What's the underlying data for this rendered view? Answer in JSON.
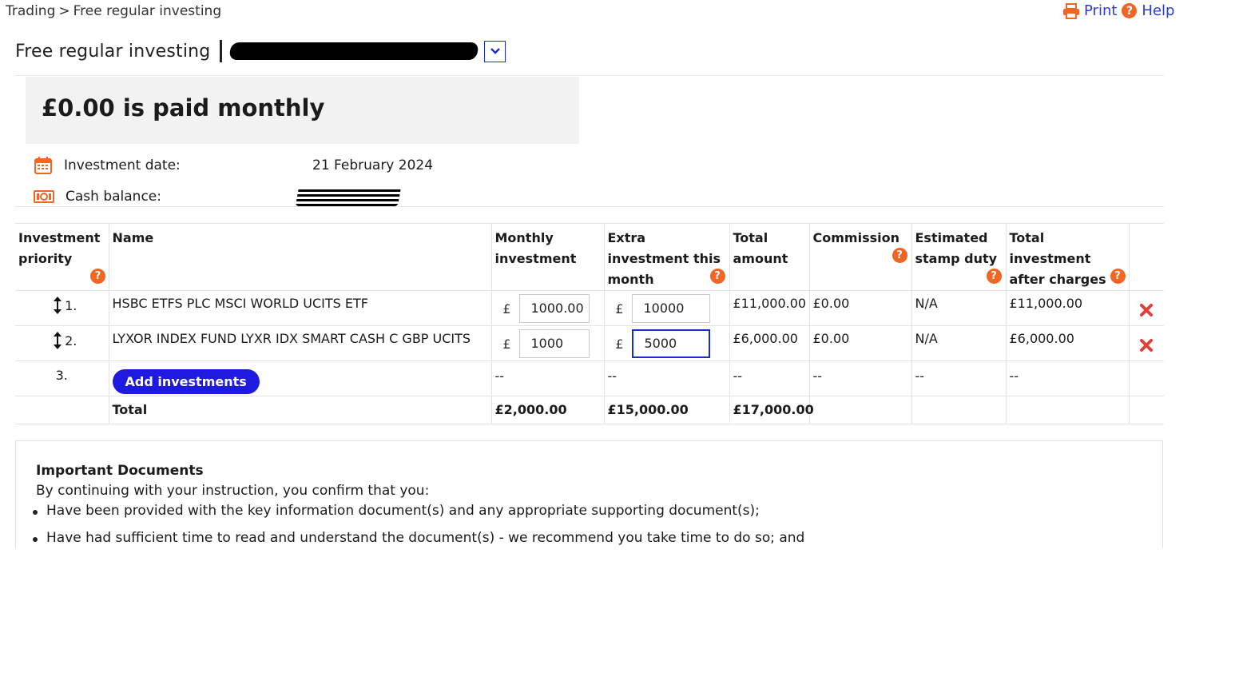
{
  "breadcrumb": {
    "parent": "Trading",
    "separator": ">",
    "current": "Free regular investing"
  },
  "toolbar": {
    "print_label": "Print",
    "help_label": "Help"
  },
  "header": {
    "title": "Free regular investing"
  },
  "summary": {
    "headline": "£0.00 is paid monthly"
  },
  "details": {
    "investment_date_label": "Investment date:",
    "investment_date_value": "21 February 2024",
    "cash_balance_label": "Cash balance:"
  },
  "table": {
    "headers": {
      "priority": "Investment priority",
      "name": "Name",
      "monthly": "Monthly investment",
      "extra": "Extra investment this month",
      "total": "Total amount",
      "commission": "Commission",
      "stamp": "Estimated stamp duty",
      "after": "Total investment after charges"
    },
    "currency_symbol": "£",
    "rows": [
      {
        "priority": "1.",
        "name": "HSBC ETFS PLC MSCI WORLD UCITS ETF",
        "monthly": "1000.00",
        "extra": "10000",
        "total": "£11,000.00",
        "commission": "£0.00",
        "stamp": "N/A",
        "after": "£11,000.00"
      },
      {
        "priority": "2.",
        "name": "LYXOR INDEX FUND LYXR IDX SMART CASH C GBP UCITS",
        "monthly": "1000",
        "extra": "5000",
        "total": "£6,000.00",
        "commission": "£0.00",
        "stamp": "N/A",
        "after": "£6,000.00"
      }
    ],
    "add_row": {
      "priority": "3.",
      "button": "Add investments",
      "placeholder": "--"
    },
    "total_row": {
      "label": "Total",
      "monthly": "£2,000.00",
      "extra": "£15,000.00",
      "total": "£17,000.00"
    }
  },
  "documents": {
    "title": "Important Documents",
    "intro": "By continuing with your instruction, you confirm that you:",
    "items": [
      "Have been provided with the key information document(s) and any appropriate supporting document(s);",
      "Have had sufficient time to read and understand the document(s) - we recommend you take time to do so; and"
    ]
  },
  "colors": {
    "accent": "#f26522",
    "link": "#2a3bd9",
    "button": "#1f1ae0",
    "delete": "#e0413b"
  }
}
